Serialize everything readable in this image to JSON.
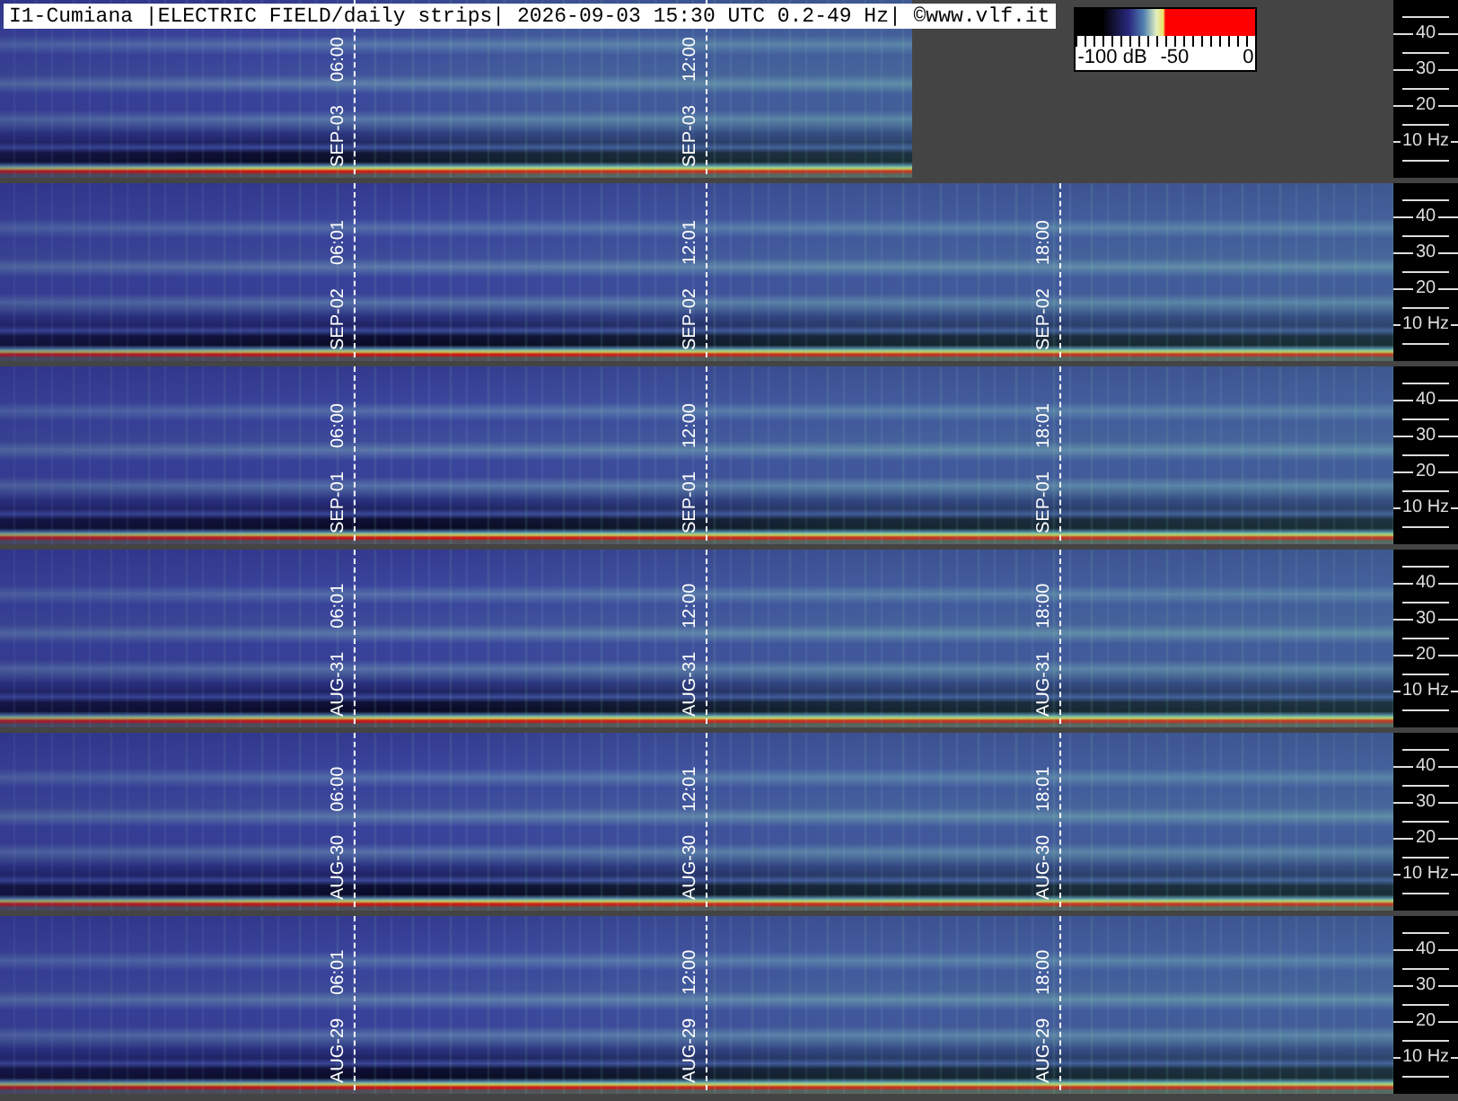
{
  "title": "I1-Cumiana |ELECTRIC FIELD/daily strips| 2026-09-03 15:30 UTC 0.2-49 Hz| ©www.vlf.it",
  "colorbar": {
    "labels": [
      "-100 dB",
      "-50",
      "0"
    ]
  },
  "strips": [
    {
      "level": 0.655,
      "markers": [
        {
          "date": "SEP-03",
          "time": "06:00"
        },
        {
          "date": "SEP-03",
          "time": "12:00"
        }
      ],
      "axis_labels": [
        "40",
        "30",
        "20",
        "10 Hz"
      ]
    },
    {
      "level": 1,
      "markers": [
        {
          "date": "SEP-02",
          "time": "06:01"
        },
        {
          "date": "SEP-02",
          "time": "12:01"
        },
        {
          "date": "SEP-02",
          "time": "18:00"
        }
      ],
      "axis_labels": [
        "40",
        "30",
        "20",
        "10 Hz"
      ]
    },
    {
      "level": 1,
      "markers": [
        {
          "date": "SEP-01",
          "time": "06:00"
        },
        {
          "date": "SEP-01",
          "time": "12:00"
        },
        {
          "date": "SEP-01",
          "time": "18:01"
        }
      ],
      "axis_labels": [
        "40",
        "30",
        "20",
        "10 Hz"
      ]
    },
    {
      "level": 1,
      "markers": [
        {
          "date": "AUG-31",
          "time": "06:01"
        },
        {
          "date": "AUG-31",
          "time": "12:00"
        },
        {
          "date": "AUG-31",
          "time": "18:00"
        }
      ],
      "axis_labels": [
        "40",
        "30",
        "20",
        "10 Hz"
      ]
    },
    {
      "level": 1,
      "markers": [
        {
          "date": "AUG-30",
          "time": "06:00"
        },
        {
          "date": "AUG-30",
          "time": "12:01"
        },
        {
          "date": "AUG-30",
          "time": "18:01"
        }
      ],
      "axis_labels": [
        "40",
        "30",
        "20",
        "10 Hz"
      ]
    },
    {
      "level": 1,
      "markers": [
        {
          "date": "AUG-29",
          "time": "06:01"
        },
        {
          "date": "AUG-29",
          "time": "12:00"
        },
        {
          "date": "AUG-29",
          "time": "18:00"
        }
      ],
      "axis_labels": [
        "40",
        "30",
        "20",
        "10 Hz"
      ]
    }
  ]
}
